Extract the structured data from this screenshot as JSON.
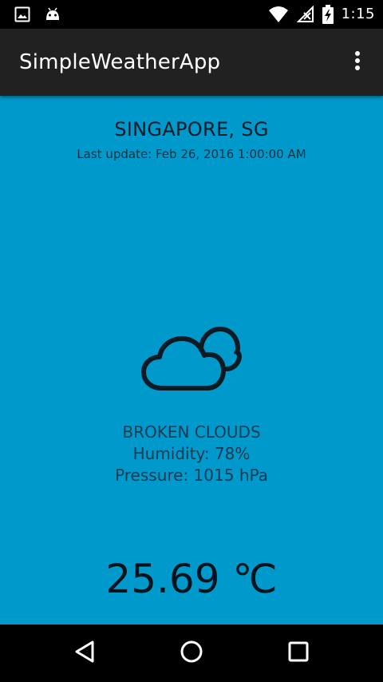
{
  "status_bar": {
    "time": "1:15",
    "icons": [
      "image-notification-icon",
      "android-notification-icon",
      "wifi-icon",
      "no-signal-icon",
      "battery-charging-icon"
    ]
  },
  "app_bar": {
    "title": "SimpleWeatherApp",
    "menu_icon": "overflow-menu-icon"
  },
  "weather": {
    "city": "SINGAPORE, SG",
    "last_update": "Last update: Feb 26, 2016 1:00:00 AM",
    "icon": "broken-clouds-icon",
    "description": "BROKEN CLOUDS",
    "humidity": "Humidity: 78%",
    "pressure": "Pressure: 1015 hPa",
    "temperature": "25.69 ℃"
  },
  "nav_bar": {
    "back": "back-icon",
    "home": "home-icon",
    "recents": "recents-icon"
  },
  "colors": {
    "background": "#0099cc",
    "app_bar": "#212121",
    "status_bar": "#000000"
  }
}
